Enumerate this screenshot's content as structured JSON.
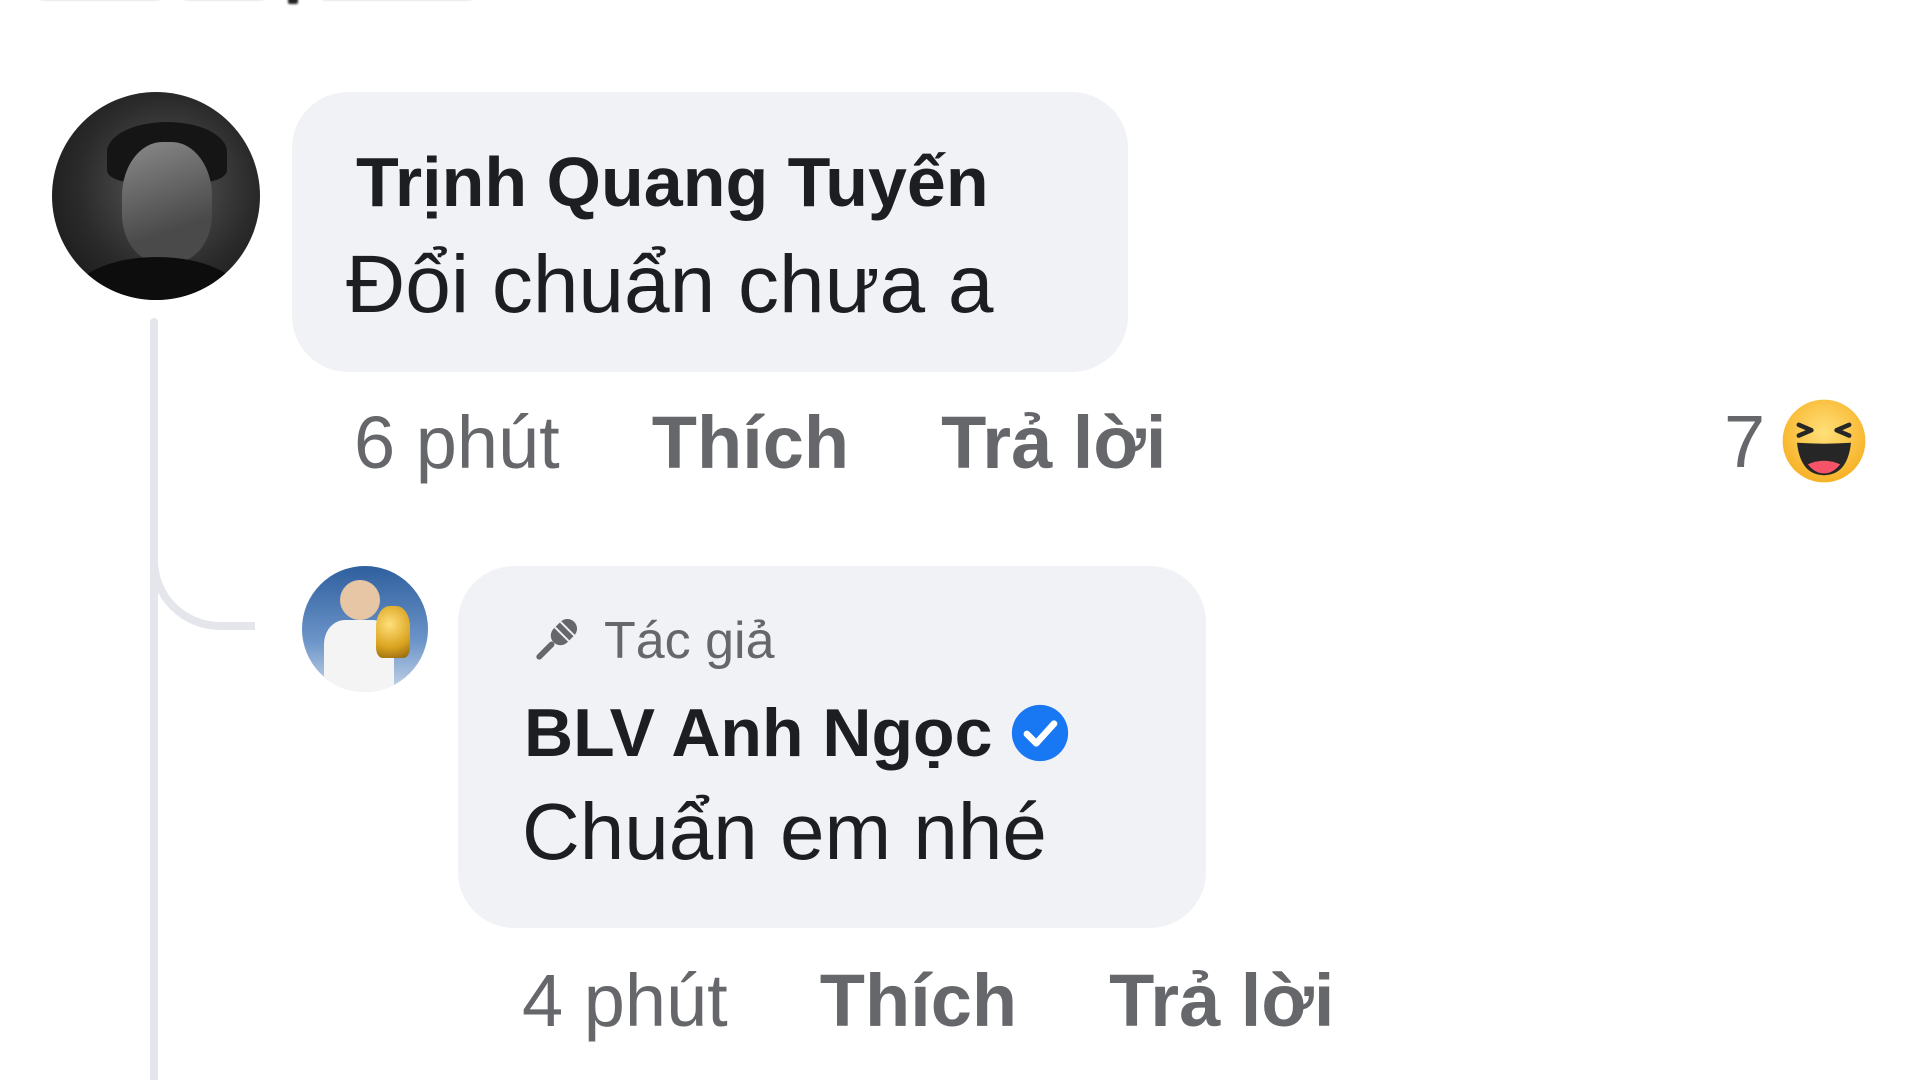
{
  "comment": {
    "author": "Trịnh Quang Tuyến",
    "text": "Đổi chuẩn chưa a",
    "time": "6 phút",
    "like_label": "Thích",
    "reply_label": "Trả lời",
    "reaction_count": "7",
    "reaction_icon": "haha-icon"
  },
  "reply": {
    "badge": "Tác giả",
    "badge_icon": "microphone-icon",
    "author": "BLV Anh Ngọc",
    "verified_icon": "verified-badge-icon",
    "text": "Chuẩn em nhé",
    "time": "4 phút",
    "like_label": "Thích",
    "reply_label": "Trả lời"
  },
  "colors": {
    "bubble": "#f0f2f5",
    "name": "#1c1e21",
    "meta": "#65676b",
    "verified": "#1877f2",
    "haha": "#f7b125"
  }
}
